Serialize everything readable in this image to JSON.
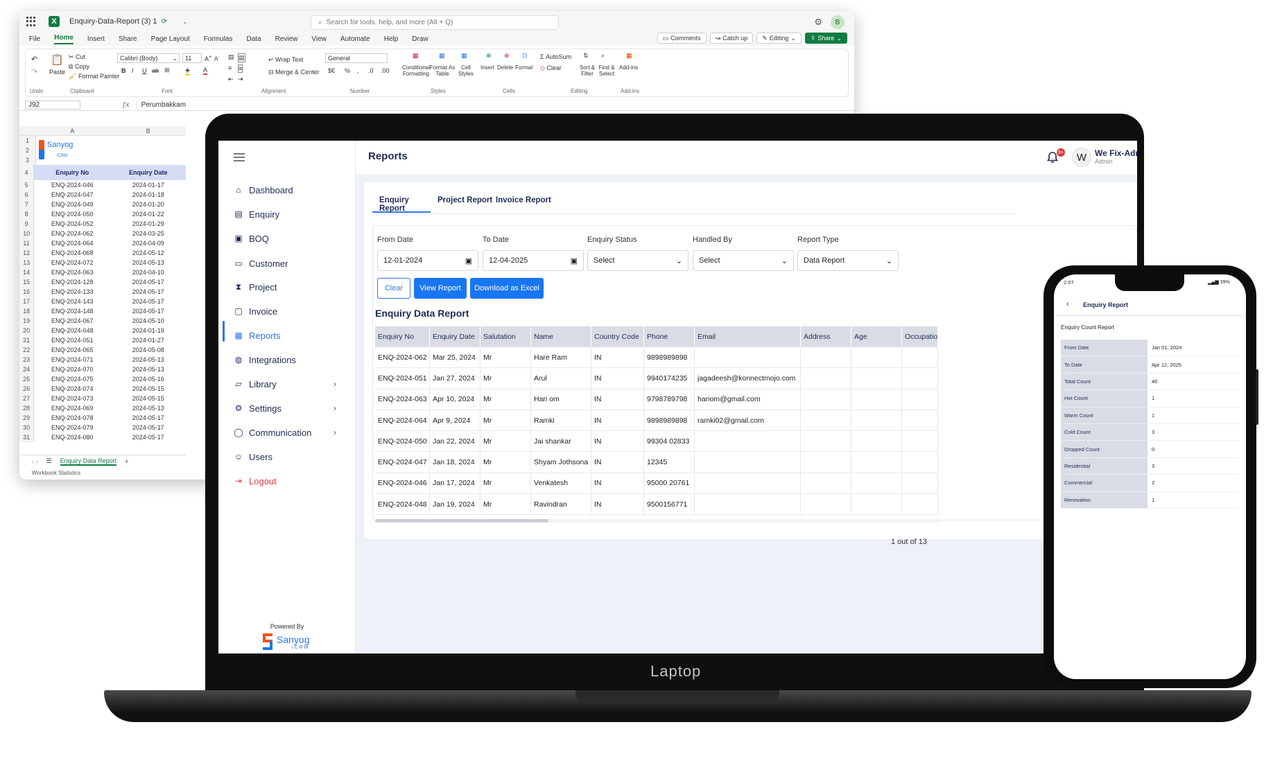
{
  "excel": {
    "file_name": "Enquiry-Data-Report (3) 1",
    "search_placeholder": "Search for tools, help, and more (Alt + Q)",
    "avatar": "B",
    "menu": [
      "File",
      "Home",
      "Insert",
      "Share",
      "Page Layout",
      "Formulas",
      "Data",
      "Review",
      "View",
      "Automate",
      "Help",
      "Draw"
    ],
    "menu_active": "Home",
    "top_buttons": {
      "comments": "Comments",
      "catch_up": "Catch up",
      "editing": "Editing",
      "share": "Share"
    },
    "ribbon": {
      "undo": "Undo",
      "paste": "Paste",
      "cut": "Cut",
      "copy": "Copy",
      "format_painter": "Format Painter",
      "clipboard": "Clipboard",
      "font_name": "Calibri (Body)",
      "font_size": "11",
      "font": "Font",
      "wrap_text": "Wrap Text",
      "merge_center": "Merge & Center",
      "alignment": "Alignment",
      "number_format": "General",
      "number": "Number",
      "conditional": "Conditional Formatting",
      "format_as_table": "Format As Table",
      "cell_styles": "Cell Styles",
      "styles": "Styles",
      "insert": "Insert",
      "delete": "Delete",
      "format": "Format",
      "cells": "Cells",
      "autosum": "AutoSum",
      "clear": "Clear",
      "sort_filter": "Sort & Filter",
      "find_select": "Find & Select",
      "editing": "Editing",
      "addins": "Add-ins"
    },
    "name_box": "J92",
    "formula_value": "Perumbakkam",
    "columns": [
      "A",
      "B"
    ],
    "header_row": {
      "num": "4",
      "a": "Enquiry No",
      "b": "Enquiry Date"
    },
    "logo_text": "Sanyog",
    "logo_sub": "iCRM",
    "rows": [
      {
        "n": "5",
        "a": "ENQ-2024-046",
        "b": "2024-01-17"
      },
      {
        "n": "6",
        "a": "ENQ-2024-047",
        "b": "2024-01-18"
      },
      {
        "n": "7",
        "a": "ENQ-2024-049",
        "b": "2024-01-20"
      },
      {
        "n": "8",
        "a": "ENQ-2024-050",
        "b": "2024-01-22"
      },
      {
        "n": "9",
        "a": "ENQ-2024-052",
        "b": "2024-01-29"
      },
      {
        "n": "10",
        "a": "ENQ-2024-062",
        "b": "2024-03-25"
      },
      {
        "n": "11",
        "a": "ENQ-2024-064",
        "b": "2024-04-09"
      },
      {
        "n": "12",
        "a": "ENQ-2024-068",
        "b": "2024-05-12"
      },
      {
        "n": "13",
        "a": "ENQ-2024-072",
        "b": "2024-05-13"
      },
      {
        "n": "14",
        "a": "ENQ-2024-063",
        "b": "2024-04-10"
      },
      {
        "n": "15",
        "a": "ENQ-2024-128",
        "b": "2024-05-17"
      },
      {
        "n": "16",
        "a": "ENQ-2024-133",
        "b": "2024-05-17"
      },
      {
        "n": "17",
        "a": "ENQ-2024-143",
        "b": "2024-05-17"
      },
      {
        "n": "18",
        "a": "ENQ-2024-148",
        "b": "2024-05-17"
      },
      {
        "n": "19",
        "a": "ENQ-2024-067",
        "b": "2024-05-10"
      },
      {
        "n": "20",
        "a": "ENQ-2024-048",
        "b": "2024-01-19"
      },
      {
        "n": "21",
        "a": "ENQ-2024-051",
        "b": "2024-01-27"
      },
      {
        "n": "22",
        "a": "ENQ-2024-065",
        "b": "2024-05-08"
      },
      {
        "n": "23",
        "a": "ENQ-2024-071",
        "b": "2024-05-13"
      },
      {
        "n": "24",
        "a": "ENQ-2024-070",
        "b": "2024-05-13"
      },
      {
        "n": "25",
        "a": "ENQ-2024-075",
        "b": "2024-05-16"
      },
      {
        "n": "26",
        "a": "ENQ-2024-074",
        "b": "2024-05-15"
      },
      {
        "n": "27",
        "a": "ENQ-2024-073",
        "b": "2024-05-15"
      },
      {
        "n": "28",
        "a": "ENQ-2024-069",
        "b": "2024-05-13"
      },
      {
        "n": "29",
        "a": "ENQ-2024-078",
        "b": "2024-05-17"
      },
      {
        "n": "30",
        "a": "ENQ-2024-079",
        "b": "2024-05-17"
      },
      {
        "n": "31",
        "a": "ENQ-2024-080",
        "b": "2024-05-17"
      }
    ],
    "sheet_tab": "Enquiry Data Report",
    "status": "Workbook Statistics"
  },
  "app": {
    "laptop_label": "Laptop",
    "page_title": "Reports",
    "notification_count": "9+",
    "user": {
      "initial": "W",
      "name": "We Fix-Admin",
      "role": "Admin"
    },
    "nav": [
      {
        "label": "Dashboard"
      },
      {
        "label": "Enquiry"
      },
      {
        "label": "BOQ"
      },
      {
        "label": "Customer"
      },
      {
        "label": "Project"
      },
      {
        "label": "Invoice"
      },
      {
        "label": "Reports"
      },
      {
        "label": "Integrations"
      },
      {
        "label": "Library"
      },
      {
        "label": "Settings"
      },
      {
        "label": "Communication"
      },
      {
        "label": "Users"
      },
      {
        "label": "Logout"
      }
    ],
    "powered_by": "Powered By",
    "brand": {
      "name": "Sanyog",
      "sub": "iCRM"
    },
    "tabs": [
      "Enquiry Report",
      "Project Report",
      "Invoice Report"
    ],
    "filters": {
      "from_date_label": "From Date",
      "from_date": "12-01-2024",
      "to_date_label": "To Date",
      "to_date": "12-04-2025",
      "status_label": "Enquiry Status",
      "status_value": "Select",
      "handled_label": "Handled By",
      "handled_value": "Select",
      "type_label": "Report Type",
      "type_value": "Data Report"
    },
    "buttons": {
      "clear": "Clear",
      "view": "View Report",
      "download": "Download as Excel"
    },
    "report_title": "Enquiry Data Report",
    "columns": [
      "Enquiry No",
      "Enquiry Date",
      "Salutation",
      "Name",
      "Country Code",
      "Phone",
      "Email",
      "Address",
      "Age",
      "Occupatio"
    ],
    "rows": [
      [
        "ENQ-2024-062",
        "Mar 25, 2024",
        "Mr",
        "Hare Ram",
        "IN",
        "9898989898",
        "",
        "",
        "",
        ""
      ],
      [
        "ENQ-2024-051",
        "Jan 27, 2024",
        "Mr",
        "Arul",
        "IN",
        "9940174235",
        "jagadeesh@konnectmojo.com",
        "",
        "",
        ""
      ],
      [
        "ENQ-2024-063",
        "Apr 10, 2024",
        "Mr",
        "Hari om",
        "IN",
        "9798789798",
        "hariom@gmail.com",
        "",
        "",
        ""
      ],
      [
        "ENQ-2024-064",
        "Apr 9, 2024",
        "Mr",
        "Ramki",
        "IN",
        "9898989898",
        "ramki02@gmail.com",
        "",
        "",
        ""
      ],
      [
        "ENQ-2024-050",
        "Jan 22, 2024",
        "Mr",
        "Jai shankar",
        "IN",
        "99304 02833",
        "",
        "",
        "",
        ""
      ],
      [
        "ENQ-2024-047",
        "Jan 18, 2024",
        "Mr",
        "Shyam Jothsona",
        "IN",
        "12345",
        "",
        "",
        "",
        ""
      ],
      [
        "ENQ-2024-046",
        "Jan 17, 2024",
        "Mr",
        "Venkatesh",
        "IN",
        "95000 20761",
        "",
        "",
        "",
        ""
      ],
      [
        "ENQ-2024-048",
        "Jan 19, 2024",
        "Mr",
        "Ravindran",
        "IN",
        "9500156771",
        "",
        "",
        "",
        ""
      ]
    ],
    "pager": "1 out of 13"
  },
  "phone": {
    "time": "2:07",
    "battery": "39%",
    "title": "Enquiry Report",
    "subtitle": "Enquiry Count Report",
    "rows": [
      {
        "k": "From Date",
        "v": "Jan 01, 2024"
      },
      {
        "k": "To Date",
        "v": "Apr 12, 2025"
      },
      {
        "k": "Total Count",
        "v": "40"
      },
      {
        "k": "Hot Count",
        "v": "1"
      },
      {
        "k": "Warm Count",
        "v": "1"
      },
      {
        "k": "Cold Count",
        "v": "3"
      },
      {
        "k": "Dropped Count",
        "v": "0"
      },
      {
        "k": "Residential",
        "v": "3"
      },
      {
        "k": "Commercial",
        "v": "2"
      },
      {
        "k": "Renovation",
        "v": "1"
      }
    ]
  },
  "colors": {
    "accent": "#2f74e8",
    "excel_green": "#107c41",
    "danger": "#e23b3b"
  }
}
